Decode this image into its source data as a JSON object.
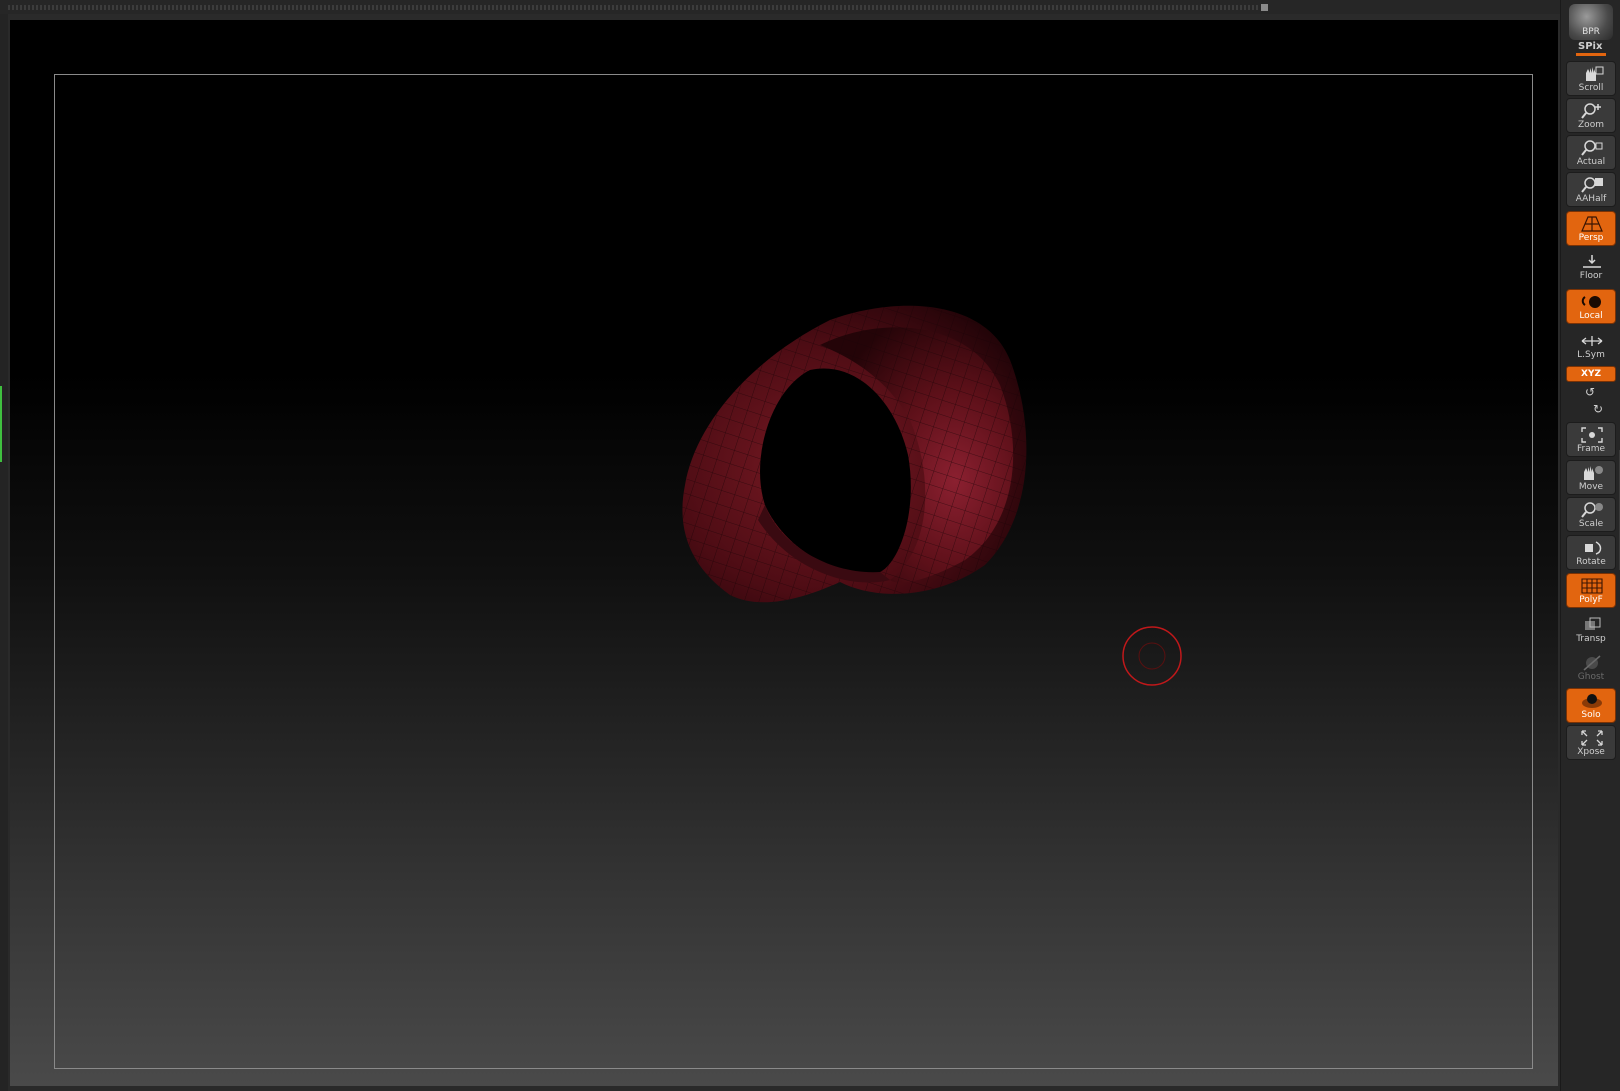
{
  "toolbar": {
    "bpr": "BPR",
    "spix": "SPix",
    "xyz": "XYZ",
    "buttons": [
      {
        "id": "scroll",
        "label": "Scroll",
        "icon": "hand-scroll-icon",
        "active": false
      },
      {
        "id": "zoom",
        "label": "Zoom",
        "icon": "magnifier-zoom-icon",
        "active": false
      },
      {
        "id": "actual",
        "label": "Actual",
        "icon": "magnifier-actual-icon",
        "active": false
      },
      {
        "id": "aahalf",
        "label": "AAHalf",
        "icon": "magnifier-aahalf-icon",
        "active": false
      },
      {
        "id": "persp",
        "label": "Persp",
        "icon": "perspective-grid-icon",
        "active": true
      },
      {
        "id": "floor",
        "label": "Floor",
        "icon": "floor-icon",
        "active": false
      },
      {
        "id": "local",
        "label": "Local",
        "icon": "local-pivot-icon",
        "active": true
      },
      {
        "id": "lsym",
        "label": "L.Sym",
        "icon": "local-symmetry-icon",
        "active": false
      },
      {
        "id": "frame",
        "label": "Frame",
        "icon": "frame-icon",
        "active": false
      },
      {
        "id": "move",
        "label": "Move",
        "icon": "hand-move-icon",
        "active": false
      },
      {
        "id": "scale",
        "label": "Scale",
        "icon": "magnifier-scale-icon",
        "active": false
      },
      {
        "id": "rotate",
        "label": "Rotate",
        "icon": "rotate-icon",
        "active": false
      },
      {
        "id": "polyf",
        "label": "PolyF",
        "icon": "polyframe-icon",
        "active": true
      },
      {
        "id": "transp",
        "label": "Transp",
        "icon": "transparency-icon",
        "active": false
      },
      {
        "id": "ghost",
        "label": "Ghost",
        "icon": "ghost-icon",
        "active": false
      },
      {
        "id": "solo",
        "label": "Solo",
        "icon": "solo-icon",
        "active": true
      },
      {
        "id": "xpose",
        "label": "Xpose",
        "icon": "xpose-icon",
        "active": false
      }
    ]
  },
  "colors": {
    "accent": "#e2650f",
    "mesh": "#5a0d14",
    "cursor": "#c0181a",
    "indicator": "#3fbf3f"
  }
}
